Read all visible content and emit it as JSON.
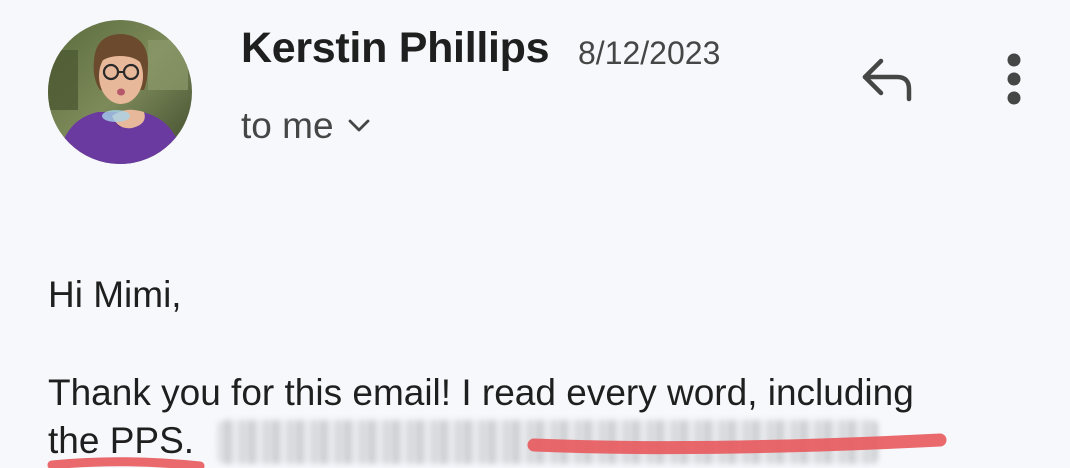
{
  "email": {
    "sender_name": "Kerstin Phillips",
    "date": "8/12/2023",
    "recipient_label": "to me"
  },
  "icons": {
    "avatar": "avatar-photo",
    "expand": "chevron-down-icon",
    "reply": "reply-icon",
    "more": "more-vert-icon"
  },
  "body": {
    "greeting": "Hi Mimi,",
    "paragraph_line1": "Thank you for this email! I read every word, including",
    "paragraph_line2": "the PPS."
  },
  "colors": {
    "background": "#f6f8fc",
    "highlight_underline": "#e8595c",
    "avatar_shirt": "#6a3aa0"
  }
}
